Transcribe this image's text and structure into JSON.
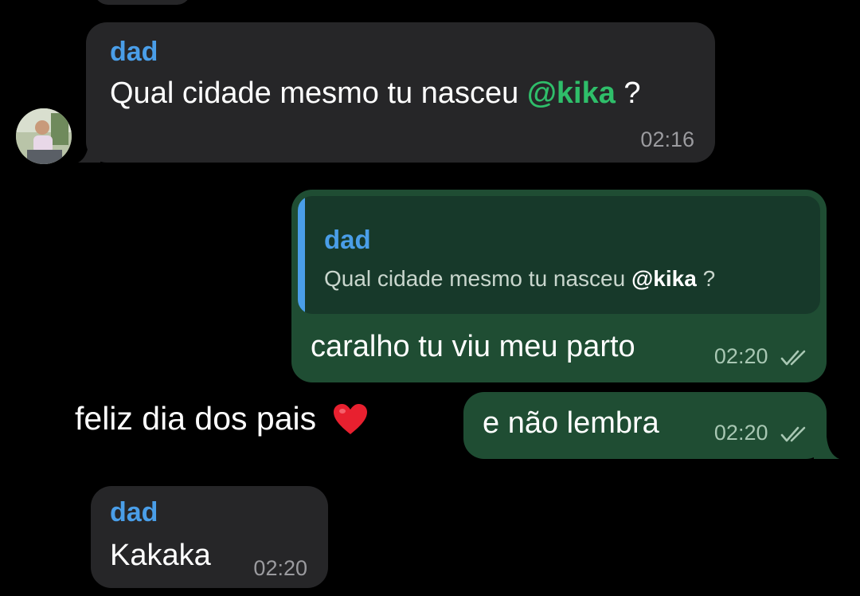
{
  "messages": {
    "m1": {
      "sender": "dad",
      "text_before": "Qual cidade mesmo tu nasceu ",
      "mention": "@kika",
      "text_after": " ?",
      "time": "02:16"
    },
    "m2": {
      "quote_sender": "dad",
      "quote_before": "Qual cidade mesmo tu nasceu ",
      "quote_mention": "@kika",
      "quote_after": " ?",
      "text": "caralho tu viu meu parto",
      "time": "02:20"
    },
    "m3": {
      "text": "e não lembra",
      "time": "02:20"
    },
    "m4": {
      "sender": "dad",
      "text": "Kakaka",
      "time": "02:20"
    }
  },
  "overlay_caption": "feliz dia dos pais",
  "overlay_emoji": "heart-icon",
  "colors": {
    "background": "#000000",
    "incoming_bubble": "#262628",
    "outgoing_bubble": "#1f4d33",
    "sender_name": "#4a9ee8",
    "mention": "#2fbe6a"
  }
}
